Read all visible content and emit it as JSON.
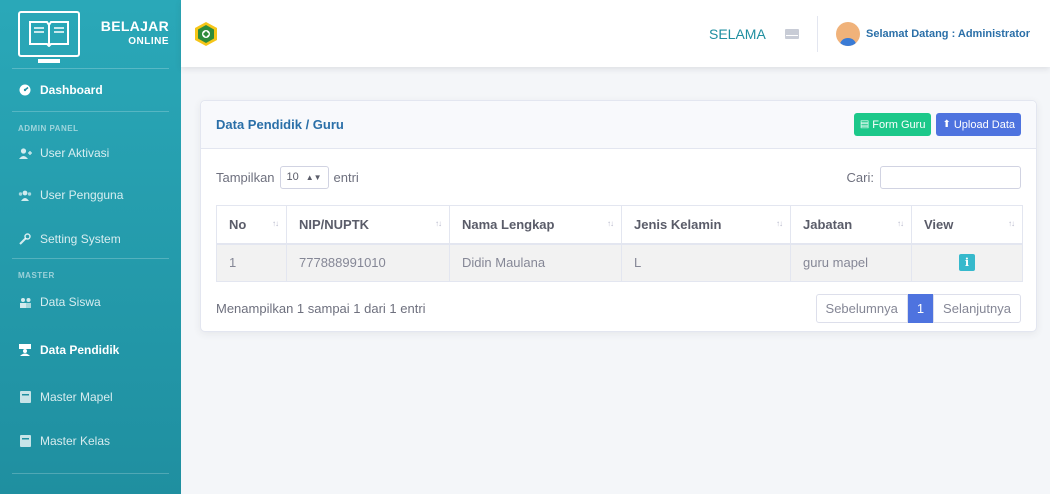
{
  "brand": {
    "line1": "BELAJAR",
    "line2": "ONLINE"
  },
  "sidebar": {
    "dashboard": "Dashboard",
    "heading_admin": "ADMIN PANEL",
    "admin_items": [
      "User Aktivasi",
      "User Pengguna",
      "Setting System"
    ],
    "heading_master": "MASTER",
    "master_items": [
      "Data Siswa",
      "Data Pendidik",
      "Master Mapel",
      "Master Kelas"
    ]
  },
  "topbar": {
    "marquee": "SELAMA",
    "user_greeting": "Selamat Datang : Administrator"
  },
  "card": {
    "title": "Data Pendidik / Guru",
    "form_button": "Form Guru",
    "upload_button": "Upload Data"
  },
  "controls": {
    "show_label": "Tampilkan",
    "page_size": "10",
    "entries_label": "entri",
    "search_label": "Cari:"
  },
  "table": {
    "headers": [
      "No",
      "NIP/NUPTK",
      "Nama Lengkap",
      "Jenis Kelamin",
      "Jabatan",
      "View"
    ],
    "rows": [
      {
        "no": "1",
        "nip": "777888991010",
        "nama": "Didin Maulana",
        "jk": "L",
        "jabatan": "guru mapel",
        "view": "i"
      }
    ]
  },
  "footer": {
    "info": "Menampilkan 1 sampai 1 dari 1 entri",
    "prev": "Sebelumnya",
    "page": "1",
    "next": "Selanjutnya"
  },
  "colors": {
    "sidebar": "#1f8fa0",
    "primary": "#4e73df",
    "success": "#1cc88a",
    "info": "#36b9cc"
  }
}
